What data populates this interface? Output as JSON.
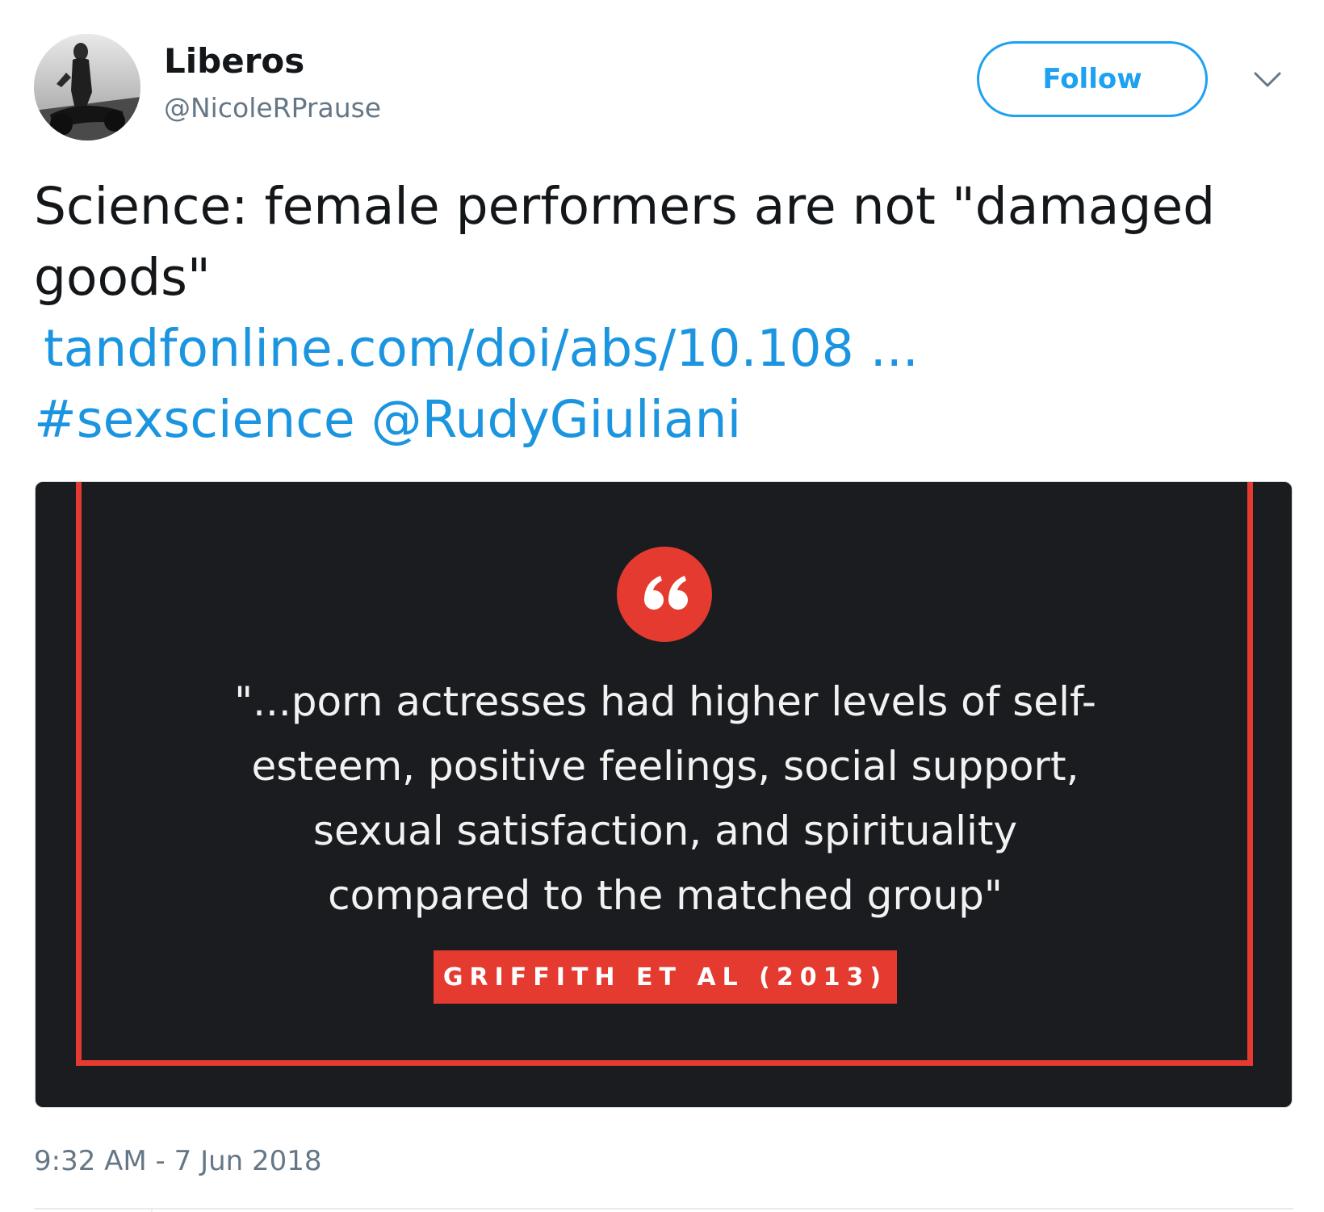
{
  "header": {
    "display_name": "Liberos",
    "handle": "@NicoleRPrause",
    "follow_label": "Follow",
    "menu_icon": "chevron-down-icon",
    "avatar": "profile-photo"
  },
  "tweet": {
    "text_line_1": "Science: female performers are not \"damaged",
    "text_line_2": "goods\"",
    "url": "tandfonline.com/doi/abs/10.108 ...",
    "hashtag": "#sexscience",
    "mention": "@RudyGiuliani"
  },
  "media": {
    "quote_icon": "quote-marks-icon",
    "quote_lines": [
      "\"...porn actresses had higher levels of self-",
      "esteem, positive feelings, social support,",
      "sexual satisfaction, and spirituality",
      "compared to the matched group\""
    ],
    "citation": "GRIFFITH ET AL (2013)"
  },
  "meta": {
    "timestamp": "9:32 AM - 7 Jun 2018"
  },
  "colors": {
    "link_blue": "#1b95e0",
    "follow_blue": "#1da1f2",
    "accent_red": "#e53a2f",
    "card_bg": "#1b1c1f",
    "secondary_text": "#657786"
  }
}
